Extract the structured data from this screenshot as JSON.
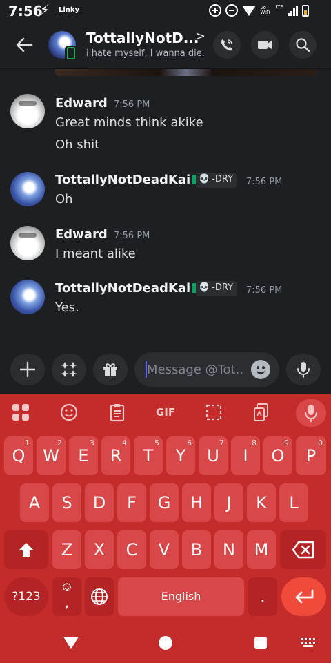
{
  "status_bar": {
    "time": "7:56",
    "carrier_label": "Linky",
    "volte_label": "Vo WiFi",
    "network_label": "LTE"
  },
  "header": {
    "name": "TottallyNotD...",
    "status_text": "i hate myself, I wanna die."
  },
  "messages": [
    {
      "author": "Edward",
      "time": "7:56 PM",
      "lines": [
        "Great minds think akike",
        "Oh shit"
      ]
    },
    {
      "author": "TottallyNotDeadKai",
      "tag": "-DRY",
      "time": "7:56 PM",
      "lines": [
        "Oh"
      ]
    },
    {
      "author": "Edward",
      "time": "7:56 PM",
      "lines": [
        "I meant alike"
      ]
    },
    {
      "author": "TottallyNotDeadKai",
      "tag": "-DRY",
      "time": "7:56 PM",
      "lines": [
        "Yes."
      ]
    }
  ],
  "composer": {
    "placeholder": "Message @Tot..."
  },
  "keyboard": {
    "toolbar": {
      "gif_label": "GIF"
    },
    "row1": [
      {
        "k": "Q",
        "n": "1"
      },
      {
        "k": "W",
        "n": "2"
      },
      {
        "k": "E",
        "n": "3"
      },
      {
        "k": "R",
        "n": "4"
      },
      {
        "k": "T",
        "n": "5"
      },
      {
        "k": "Y",
        "n": "6"
      },
      {
        "k": "U",
        "n": "7"
      },
      {
        "k": "I",
        "n": "8"
      },
      {
        "k": "O",
        "n": "9"
      },
      {
        "k": "P",
        "n": "0"
      }
    ],
    "row2": [
      "A",
      "S",
      "D",
      "F",
      "G",
      "H",
      "J",
      "K",
      "L"
    ],
    "row3": [
      "Z",
      "X",
      "C",
      "V",
      "B",
      "N",
      "M"
    ],
    "symbols_label": "?123",
    "comma_label": ",",
    "space_label": "English",
    "period_label": "."
  },
  "colors": {
    "background": "#1e1f22",
    "surface": "#2b2d31",
    "keyboard": "#c42b2b",
    "key": "#d94848",
    "enter": "#f04a3a",
    "online_green": "#23a55a"
  }
}
